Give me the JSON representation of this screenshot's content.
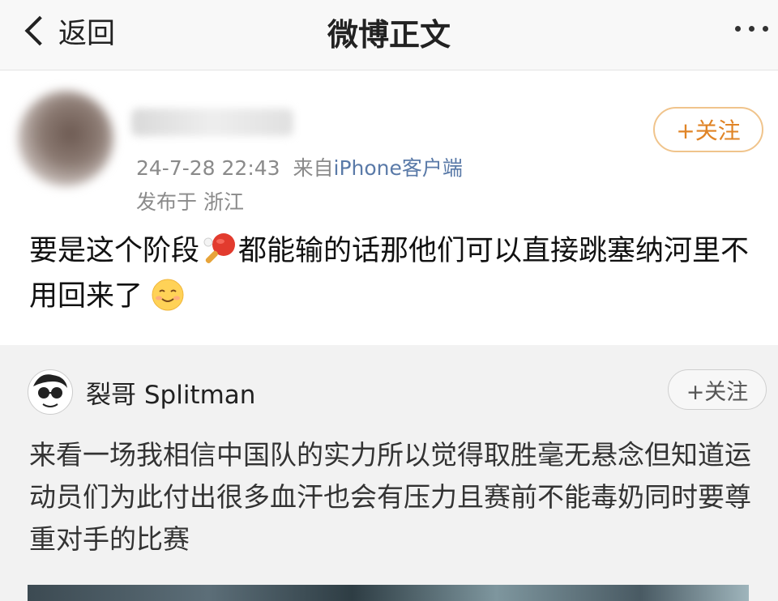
{
  "nav": {
    "back_label": "返回",
    "title": "微博正文"
  },
  "post": {
    "timestamp": "24-7-28 22:43",
    "from_prefix": "来自",
    "source": "iPhone客户端",
    "location": "发布于 浙江",
    "follow_label": "+关注",
    "text_part1": "要是这个阶段",
    "text_part2": "都能输的话那他们可以直接跳塞纳河里不用回来了",
    "emoji_1": "ping-pong-icon",
    "emoji_2": "smile-icon"
  },
  "repost": {
    "author": "裂哥 Splitman",
    "follow_label": "+关注",
    "text": "来看一场我相信中国队的实力所以觉得取胜毫无悬念但知道运动员们为此付出很多血汗也会有压力且赛前不能毒奶同时要尊重对手的比赛"
  },
  "colors": {
    "follow_primary": "#e08426",
    "source_link": "#5a7aa8"
  }
}
